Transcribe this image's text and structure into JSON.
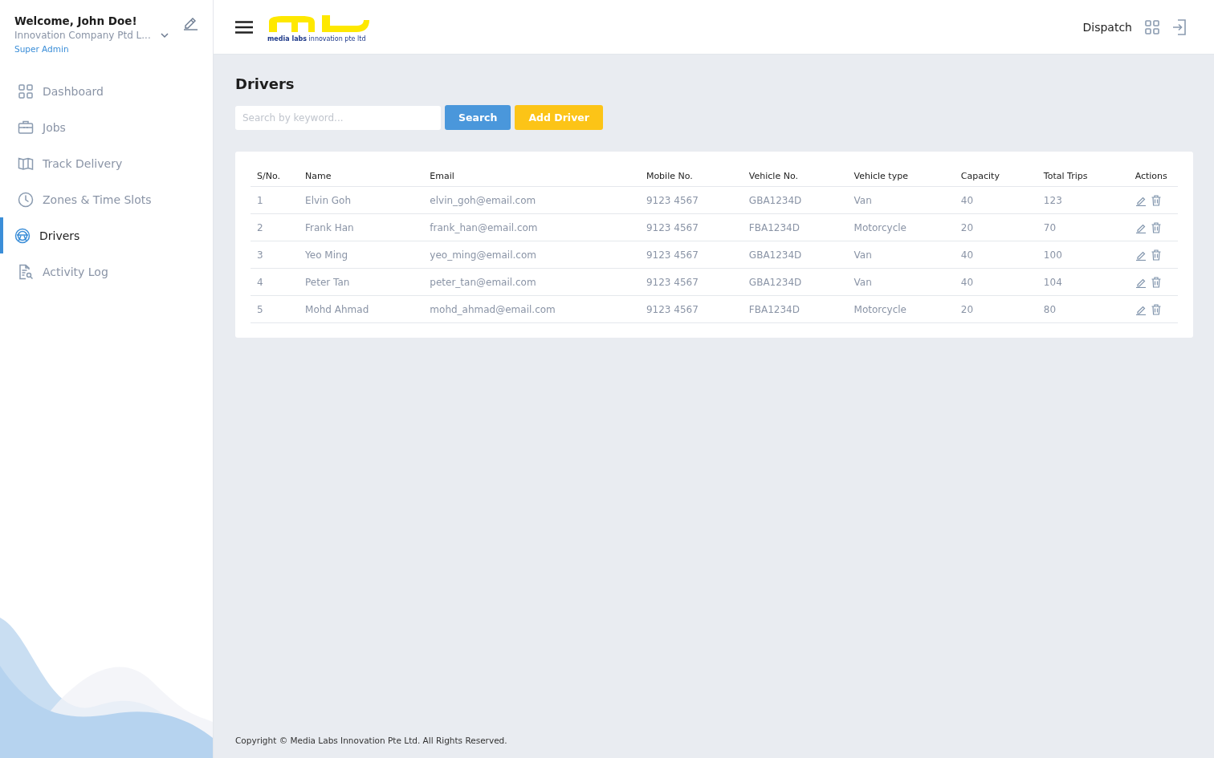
{
  "user": {
    "welcome": "Welcome, John Doe!",
    "company": "Innovation Company Ptd L...",
    "role": "Super Admin"
  },
  "nav": [
    {
      "label": "Dashboard",
      "selected": false
    },
    {
      "label": "Jobs",
      "selected": false
    },
    {
      "label": "Track Delivery",
      "selected": false
    },
    {
      "label": "Zones & Time Slots",
      "selected": false
    },
    {
      "label": "Drivers",
      "selected": true
    },
    {
      "label": "Activity Log",
      "selected": false
    }
  ],
  "logo": {
    "tagline": "**media labs** innovation pte ltd"
  },
  "topbar": {
    "label": "Dispatch"
  },
  "page": {
    "title": "Drivers",
    "search": {
      "placeholder": "Search by keyword..."
    },
    "buttons": [
      "Search",
      "Add Driver"
    ]
  },
  "table": {
    "columns": [
      "S/No.",
      "Name",
      "Email",
      "Mobile No.",
      "Vehicle No.",
      "Vehicle type",
      "Capacity",
      "Total Trips",
      "Actions"
    ],
    "rows": [
      [
        "1",
        "Elvin Goh",
        "elvin_goh@email.com",
        "9123 4567",
        "GBA1234D",
        "Van",
        "40",
        "123"
      ],
      [
        "2",
        "Frank Han",
        "frank_han@email.com",
        "9123 4567",
        "FBA1234D",
        "Motorcycle",
        "20",
        "70"
      ],
      [
        "3",
        "Yeo Ming",
        "yeo_ming@email.com",
        "9123 4567",
        "GBA1234D",
        "Van",
        "40",
        "100"
      ],
      [
        "4",
        "Peter Tan",
        "peter_tan@email.com",
        "9123 4567",
        "GBA1234D",
        "Van",
        "40",
        "104"
      ],
      [
        "5",
        "Mohd Ahmad",
        "mohd_ahmad@email.com",
        "9123 4567",
        "FBA1234D",
        "Motorcycle",
        "20",
        "80"
      ]
    ]
  },
  "footer": "Copyright © Media Labs Innovation Pte Ltd. All Rights Reserved."
}
